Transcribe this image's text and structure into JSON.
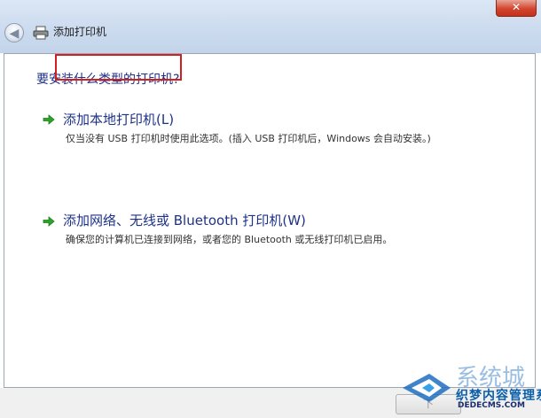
{
  "window": {
    "title": "添加打印机",
    "close_glyph": "✕",
    "back_glyph": "◀"
  },
  "main": {
    "question": "要安装什么类型的打印机?",
    "options": [
      {
        "title": "添加本地打印机(L)",
        "description": "仅当没有 USB 打印机时使用此选项。(插入 USB 打印机后，Windows 会自动安装。)"
      },
      {
        "title": "添加网络、无线或 Bluetooth 打印机(W)",
        "description": "确保您的计算机已连接到网络，或者您的 Bluetooth 或无线打印机已启用。"
      }
    ]
  },
  "footer": {
    "next_label": "下"
  },
  "watermark": {
    "large_text": "系统城",
    "line1": "织梦内容管理系统",
    "line2": "DEDECMS.COM"
  },
  "colors": {
    "link_blue": "#1e3287",
    "highlight_red": "#d22020",
    "arrow_green": "#2aa52a"
  }
}
